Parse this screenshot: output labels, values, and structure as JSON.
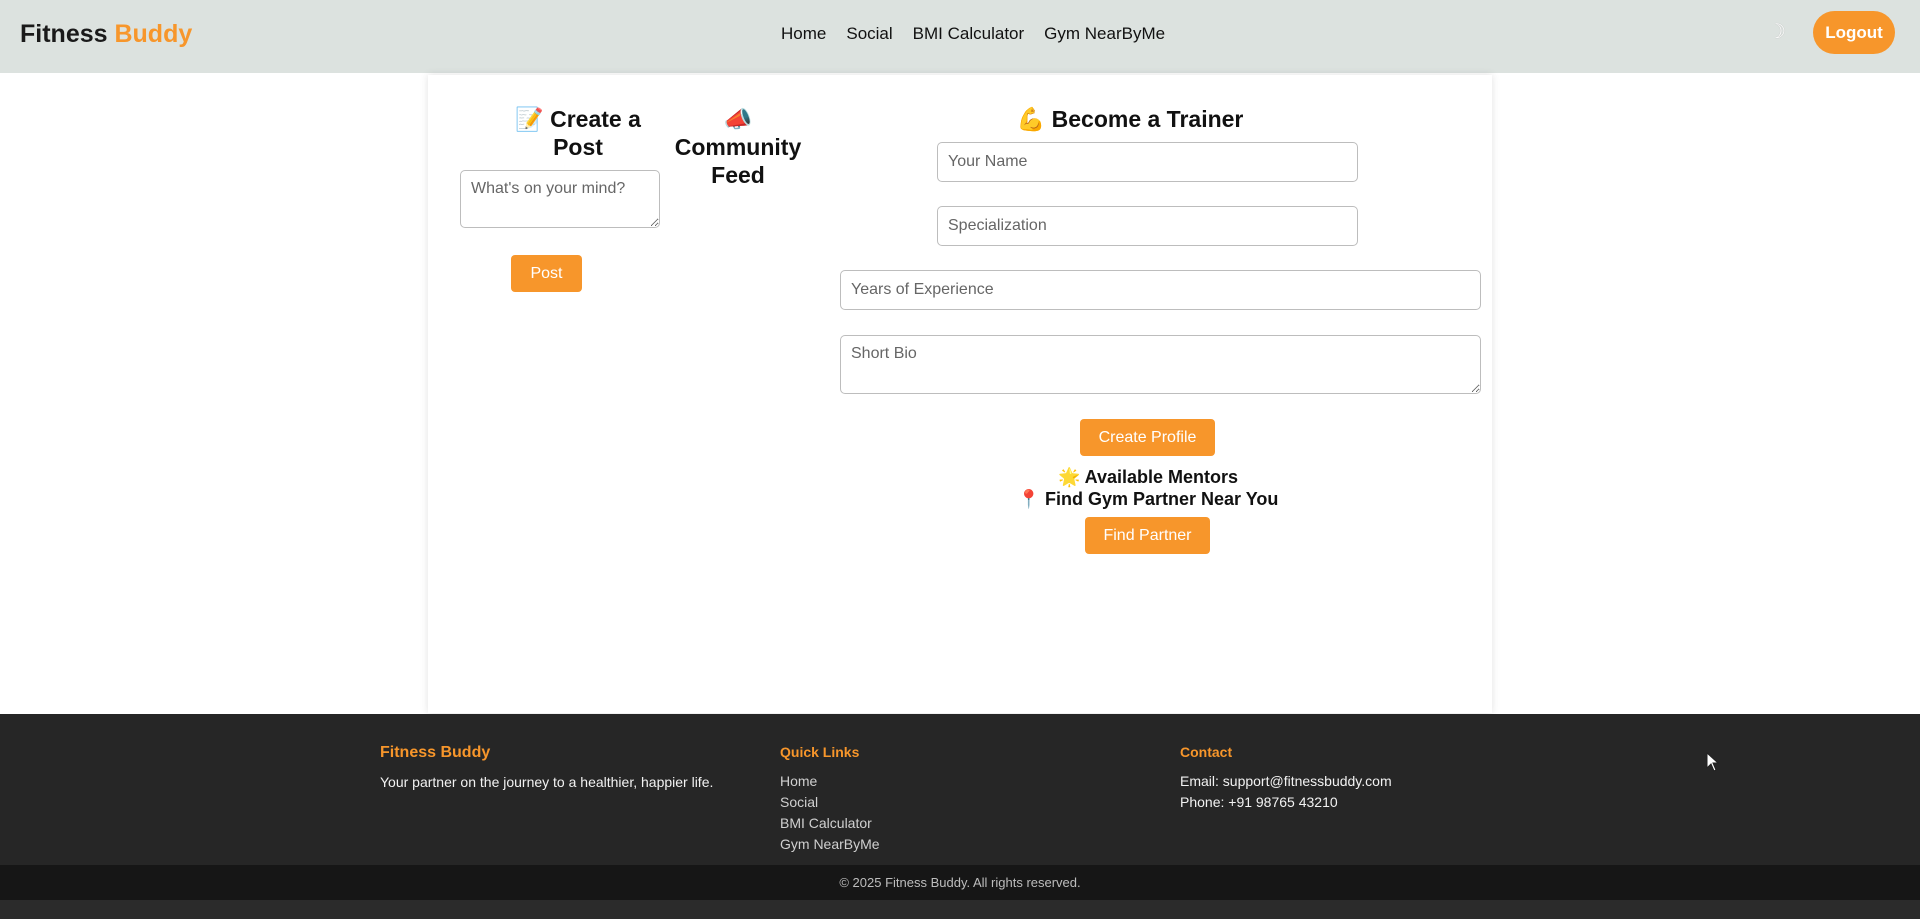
{
  "header": {
    "brand_main": "Fitness",
    "brand_accent": "Buddy",
    "nav": [
      "Home",
      "Social",
      "BMI Calculator",
      "Gym NearByMe"
    ],
    "theme_toggle": "☽",
    "logout_label": "Logout"
  },
  "post": {
    "title_line1": "📝 Create a",
    "title_line2": "Post",
    "placeholder": "What's on your mind?",
    "button": "Post"
  },
  "feed": {
    "icon": "📣",
    "title_line1": "Community",
    "title_line2": "Feed"
  },
  "trainer": {
    "title": "💪 Become a Trainer",
    "name_placeholder": "Your Name",
    "specialization_placeholder": "Specialization",
    "experience_placeholder": "Years of Experience",
    "bio_placeholder": "Short Bio",
    "create_button": "Create Profile",
    "mentors_heading": "🌟 Available Mentors",
    "partner_heading": "📍 Find Gym Partner Near You",
    "find_button": "Find Partner"
  },
  "footer": {
    "brand": "Fitness Buddy",
    "tagline": "Your partner on the journey to a healthier, happier life.",
    "quick_links_title": "Quick Links",
    "quick_links": [
      "Home",
      "Social",
      "BMI Calculator",
      "Gym NearByMe"
    ],
    "contact_title": "Contact",
    "email": "Email: support@fitnessbuddy.com",
    "phone": "Phone: +91 98765 43210",
    "copyright": "© 2025 Fitness Buddy. All rights reserved."
  },
  "colors": {
    "accent": "#f7962b",
    "navbar_bg": "#dce2df",
    "footer_bg": "#262626"
  }
}
